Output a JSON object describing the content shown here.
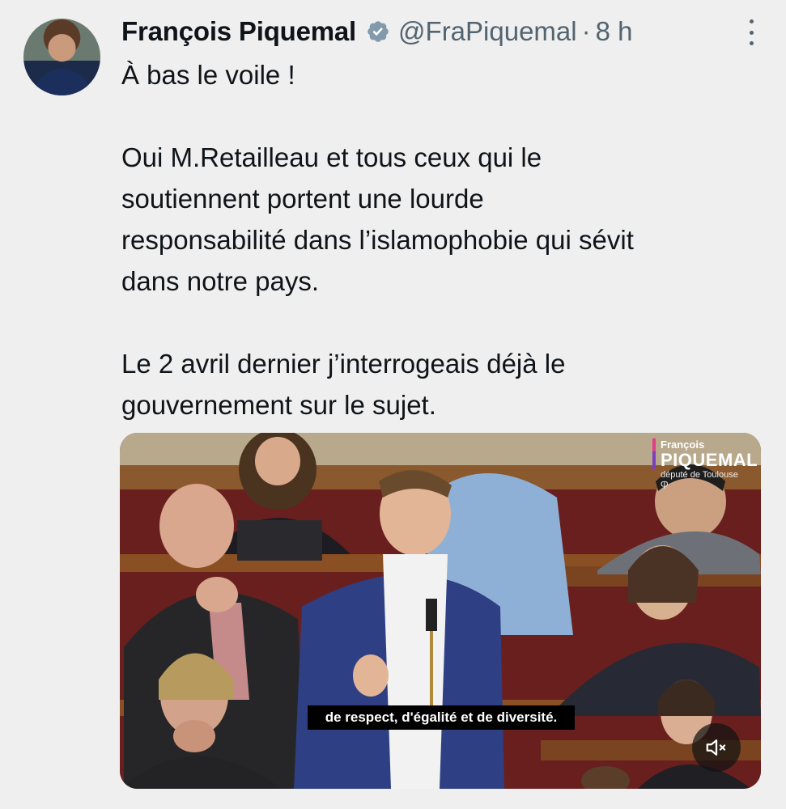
{
  "tweet": {
    "author_name": "François Piquemal",
    "handle": "@FraPiquemal",
    "separator": "·",
    "time": "8 h",
    "paragraphs": [
      "À bas le voile !",
      "Oui M.Retailleau et tous ceux qui le soutiennent portent une lourde responsabilité dans l’islamophobie qui sévit dans notre pays.",
      "Le 2 avril dernier j’interrogeais déjà le gouvernement sur le sujet."
    ],
    "lines": [
      [
        "À bas le voile !"
      ],
      [
        "Oui M.Retailleau et tous ceux qui le",
        "soutiennent portent une lourde",
        "responsabilité dans l’islamophobie qui sévit",
        "dans notre pays."
      ],
      [
        "Le 2 avril dernier j’interrogeais déjà le",
        "gouvernement sur le sujet."
      ]
    ]
  },
  "video": {
    "subtitle": "de respect, d'égalité et de diversité.",
    "logo": {
      "first_name": "François",
      "last_name": "PIQUEMAL",
      "subtitle": "député de Toulouse Ⴔ"
    }
  },
  "icons": {
    "verified": "verified-badge-icon",
    "more": "more-options-icon",
    "mute": "muted-speaker-icon"
  },
  "colors": {
    "background": "#efefef",
    "text": "#0f1419",
    "secondary_text": "#536471",
    "verified_badge": "#829aab"
  }
}
